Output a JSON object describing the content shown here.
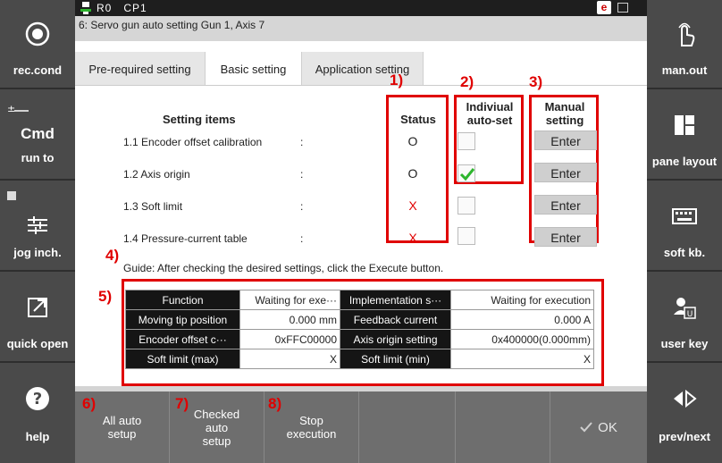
{
  "topbar": {
    "robot": "R0",
    "cp": "CP1",
    "badge": "e"
  },
  "subtitle": "6: Servo gun auto setting Gun 1, Axis 7",
  "left_sidebar": [
    {
      "label": "rec.cond",
      "icon": "record-icon"
    },
    {
      "label": "run to",
      "big": "Cmd",
      "icon": "command-icon"
    },
    {
      "label": "jog inch.",
      "icon": "sliders-icon"
    },
    {
      "label": "quick open",
      "icon": "open-external-icon"
    },
    {
      "label": "help",
      "icon": "help-icon"
    }
  ],
  "right_sidebar": [
    {
      "label": "man.out",
      "icon": "touch-hand-icon"
    },
    {
      "label": "pane layout",
      "icon": "layout-icon"
    },
    {
      "label": "soft kb.",
      "icon": "keyboard-icon"
    },
    {
      "label": "user key",
      "icon": "user-key-icon"
    },
    {
      "label": "prev/next",
      "icon": "prev-next-icon"
    }
  ],
  "tabs": [
    {
      "label": "Pre-required setting"
    },
    {
      "label": "Basic setting",
      "active": true
    },
    {
      "label": "Application setting"
    }
  ],
  "markers": [
    "1)",
    "2)",
    "3)",
    "4)",
    "5)",
    "6)",
    "7)",
    "8)"
  ],
  "headers": {
    "setting_items": "Setting items",
    "status": "Status",
    "auto_set": [
      "Indiviual",
      "auto-set"
    ],
    "manual": [
      "Manual",
      "setting"
    ]
  },
  "rows": [
    {
      "label": "1.1 Encoder offset calibration",
      "colon": ":",
      "status": "O",
      "status_ok": true,
      "checked": false,
      "enter": "Enter"
    },
    {
      "label": "1.2 Axis origin",
      "colon": ":",
      "status": "O",
      "status_ok": true,
      "checked": true,
      "enter": "Enter"
    },
    {
      "label": "1.3 Soft limit",
      "colon": ":",
      "status": "X",
      "status_ok": false,
      "checked": false,
      "enter": "Enter"
    },
    {
      "label": "1.4 Pressure-current table",
      "colon": ":",
      "status": "X",
      "status_ok": false,
      "checked": false,
      "enter": "Enter"
    }
  ],
  "guide": "Guide: After checking the desired settings, click the Execute button.",
  "info_table": [
    [
      "Function",
      "Waiting for exe···",
      "Implementation s···",
      "Waiting for execution"
    ],
    [
      "Moving tip position",
      "0.000 mm",
      "Feedback current",
      "0.000 A"
    ],
    [
      "Encoder offset c···",
      "0xFFC00000",
      "Axis origin setting",
      "0x400000(0.000mm)"
    ],
    [
      "Soft limit (max)",
      "X",
      "Soft limit (min)",
      "X"
    ]
  ],
  "bottom_buttons": [
    {
      "label": "All auto setup"
    },
    {
      "label": "Checked auto setup"
    },
    {
      "label": "Stop execution"
    },
    {
      "label": ""
    },
    {
      "label": ""
    },
    {
      "label": "OK",
      "icon": "check-icon"
    }
  ],
  "colors": {
    "marker_red": "#e00000",
    "check_green": "#2db52d",
    "status_ok": "#222222",
    "status_bad": "#e00000"
  }
}
